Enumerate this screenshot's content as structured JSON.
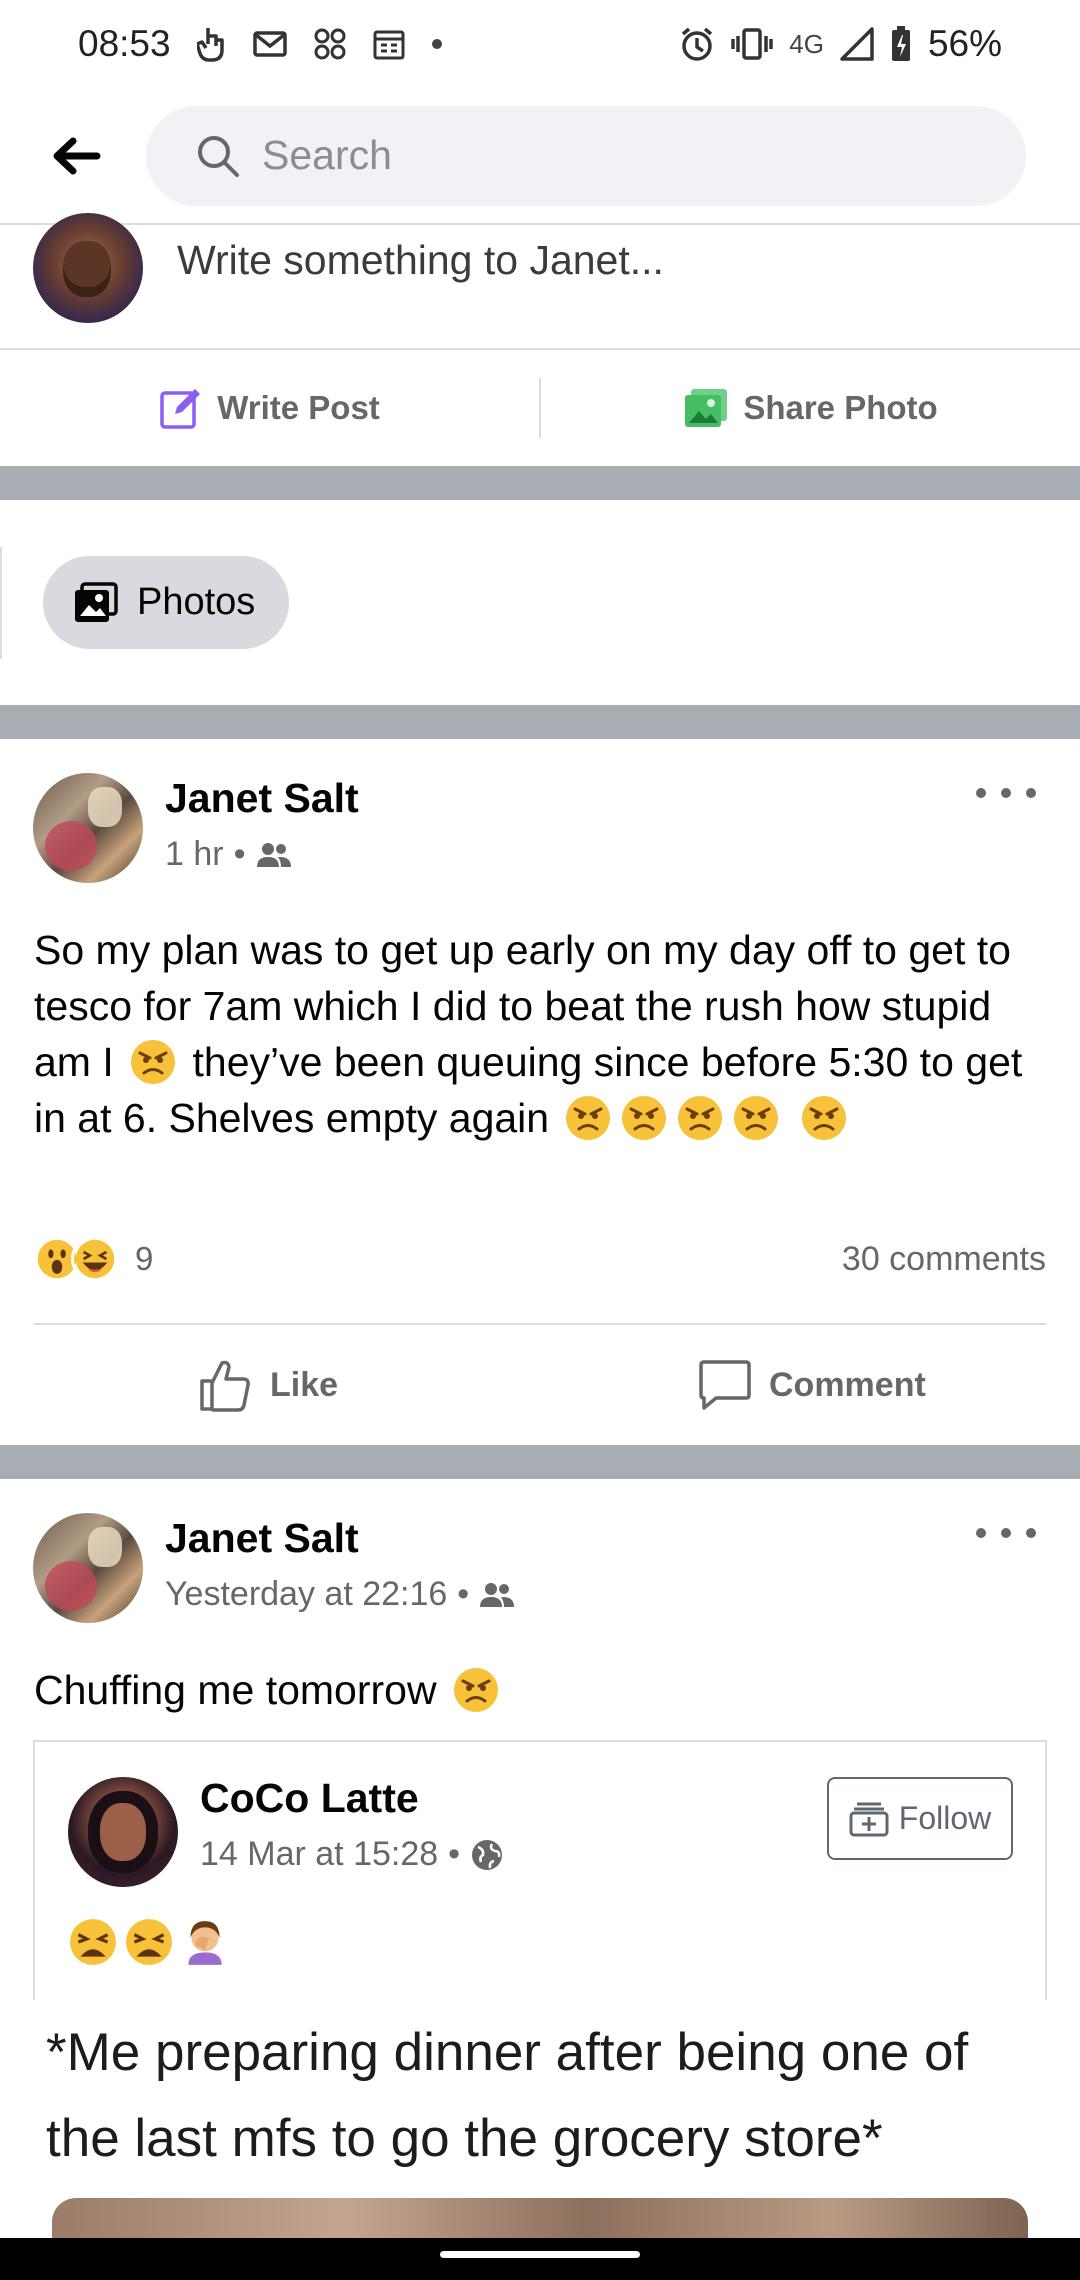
{
  "status_bar": {
    "time": "08:53",
    "network": "4G",
    "battery": "56%",
    "left_icons": [
      "touch-icon",
      "gmail-icon",
      "app-icon",
      "calendar-icon",
      "dot-icon"
    ],
    "right_icons": [
      "alarm-icon",
      "vibrate-icon",
      "signal-icon",
      "battery-icon"
    ]
  },
  "header": {
    "back_label": "←",
    "search_placeholder": "Search"
  },
  "composer": {
    "prompt": "Write something to Janet...",
    "write_post_label": "Write Post",
    "share_photo_label": "Share Photo"
  },
  "photos_chip": {
    "label": "Photos"
  },
  "posts": [
    {
      "author": "Janet Salt",
      "time": "1 hr",
      "separator": "•",
      "text_parts": [
        "So my plan was to get up early on my day off to get to tesco for 7am which I did to beat the rush how stupid am I ",
        " they’ve been queuing since before 5:30 to get in at 6. Shelves empty again "
      ],
      "reaction_count": "9",
      "comments": "30 comments",
      "like_label": "Like",
      "comment_label": "Comment"
    },
    {
      "author": "Janet Salt",
      "time": "Yesterday at 22:16",
      "separator": "•",
      "text": "Chuffing me tomorrow ",
      "shared": {
        "author": "CoCo Latte",
        "time": "14 Mar at 15:28",
        "separator": "•",
        "follow_label": "Follow"
      },
      "meme_caption": "*Me preparing dinner after being one of the last mfs to go the grocery store*"
    }
  ],
  "colors": {
    "band": "#a8adb3",
    "divider": "#dadde1",
    "secondary_text": "#65676b",
    "write_post_icon": "#8b5cf6",
    "share_photo_icon": "#45bd62"
  }
}
